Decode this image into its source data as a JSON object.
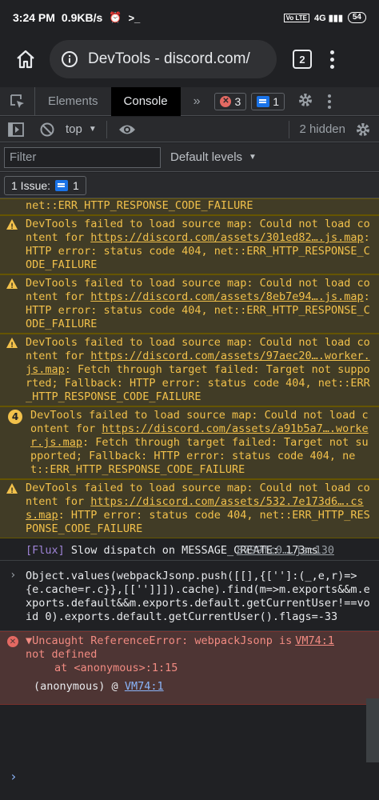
{
  "status_bar": {
    "time": "3:24 PM",
    "speed": "0.9KB/s",
    "battery": "54"
  },
  "browser": {
    "title": "DevTools - discord.com/",
    "tab_count": "2"
  },
  "devtools": {
    "tabs": {
      "elements": "Elements",
      "console": "Console"
    },
    "error_count": "3",
    "issue_count": "1",
    "context": "top",
    "hidden": "2 hidden",
    "filter_placeholder": "Filter",
    "levels": "Default levels",
    "issues_label": "1 Issue:",
    "issues_count": "1"
  },
  "console": {
    "partial_line": "net::ERR_HTTP_RESPONSE_CODE_FAILURE",
    "warnings": [
      {
        "prefix": "DevTools failed to load source map: Could not load content for ",
        "link": "https://discord.com/assets/301ed82….js.map",
        "suffix": ": HTTP error: status code 404, net::ERR_HTTP_RESPONSE_CODE_FAILURE"
      },
      {
        "prefix": "DevTools failed to load source map: Could not load content for ",
        "link": "https://discord.com/assets/8eb7e94….js.map",
        "suffix": ": HTTP error: status code 404, net::ERR_HTTP_RESPONSE_CODE_FAILURE"
      },
      {
        "prefix": "DevTools failed to load source map: Could not load content for ",
        "link": "https://discord.com/assets/97aec20….worker.js.map",
        "suffix": ": Fetch through target failed: Target not supported; Fallback: HTTP error: status code 404, net::ERR_HTTP_RESPONSE_CODE_FAILURE"
      },
      {
        "count": "4",
        "prefix": "DevTools failed to load source map: Could not load content for ",
        "link": "https://discord.com/assets/a91b5a7….worker.js.map",
        "suffix": ": Fetch through target failed: Target not supported; Fallback: HTTP error: status code 404, net::ERR_HTTP_RESPONSE_CODE_FAILURE"
      },
      {
        "prefix": "DevTools failed to load source map: Could not load content for ",
        "link": "https://discord.com/assets/532.7e173d6….css.map",
        "suffix": ": HTTP error: status code 404, net::ERR_HTTP_RESPONSE_CODE_FAILURE"
      }
    ],
    "flux": {
      "tag": "[Flux]",
      "text": " Slow dispatch on MESSAGE_CREATE: 173ms",
      "source": "8799fc0….js:130"
    },
    "input_code": "Object.values(webpackJsonp.push([[],{['']:(_,e,r)=>{e.cache=r.c}},[['']]]).cache).find(m=>m.exports&&m.exports.default&&m.exports.default.getCurrentUser!==void 0).exports.default.getCurrentUser().flags=-33",
    "error": {
      "title": "▼Uncaught ReferenceError: webpackJsonp is not defined",
      "at": "at <anonymous>:1:15",
      "source": "VM74:1",
      "stack_fn": "(anonymous)",
      "stack_at": "@",
      "stack_link": "VM74:1"
    }
  }
}
